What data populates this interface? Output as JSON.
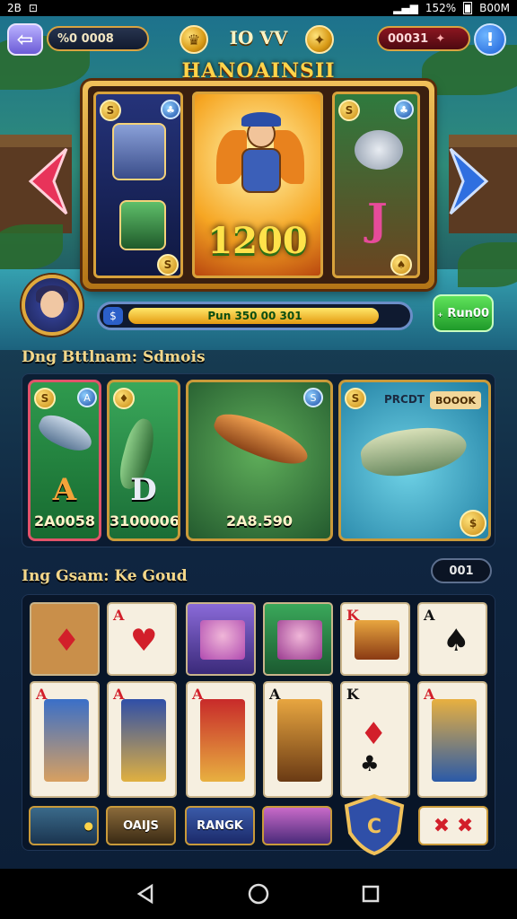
{
  "status": {
    "left": [
      "2B",
      "⊡"
    ],
    "battery_text": "152%",
    "right_text": "B00M"
  },
  "top": {
    "left_value": "%0 0008",
    "title": "IO VV",
    "left_coin": "♛",
    "right_coin": "✦",
    "right_value": "00031",
    "back_icon": "arrow-left-icon",
    "help": "!"
  },
  "game_title": "HANOAINSII",
  "featured": {
    "left_coin": "S",
    "left_gem": "♣",
    "value": "1200",
    "right_coin": "S",
    "right_gem": "♣",
    "right_badge": "♠"
  },
  "progress": {
    "text": "Pun 350 00 301",
    "fill_fraction": 0.9,
    "icon": "$"
  },
  "green_button": "₊ Run00",
  "section1": {
    "title": "Dng Bttlnam: Sdmois"
  },
  "tiles": [
    {
      "letter": "A",
      "value": "2A0058",
      "coin": "S",
      "gem": "A"
    },
    {
      "letter": "D",
      "value": "3100006",
      "coin": "♦"
    },
    {
      "value": "2A8.590",
      "gem": "S"
    },
    {
      "label": "PRCDT",
      "badge": "BOOOK",
      "coin": "$"
    }
  ],
  "section2": {
    "title": "Ing Gsam: Ke Goud",
    "count": "001"
  },
  "cards_row1": [
    {
      "rank": "",
      "suit": "♦",
      "color": "red"
    },
    {
      "rank": "A",
      "suit": "♥",
      "color": "red"
    },
    {
      "rank": "",
      "suit": "",
      "color": "black"
    },
    {
      "rank": "",
      "suit": "",
      "color": "black"
    },
    {
      "rank": "K",
      "suit": "",
      "color": "red"
    },
    {
      "rank": "A",
      "suit": "♠",
      "color": "black"
    }
  ],
  "cards_row2": [
    {
      "rank": "A",
      "suit": "♦",
      "color": "red"
    },
    {
      "rank": "A",
      "suit": "♦",
      "color": "red"
    },
    {
      "rank": "A",
      "suit": "♦",
      "color": "red"
    },
    {
      "rank": "A",
      "suit": "♣",
      "color": "black"
    },
    {
      "rank": "K",
      "suit": "♣",
      "color": "black"
    },
    {
      "rank": "A",
      "suit": "♦",
      "color": "red"
    }
  ],
  "mini_tiles": [
    "",
    "OAIJS",
    "RANGK",
    "",
    "",
    ""
  ],
  "nav": {
    "back": "triangle-back-icon",
    "home": "circle-home-icon",
    "recent": "square-recent-icon"
  }
}
